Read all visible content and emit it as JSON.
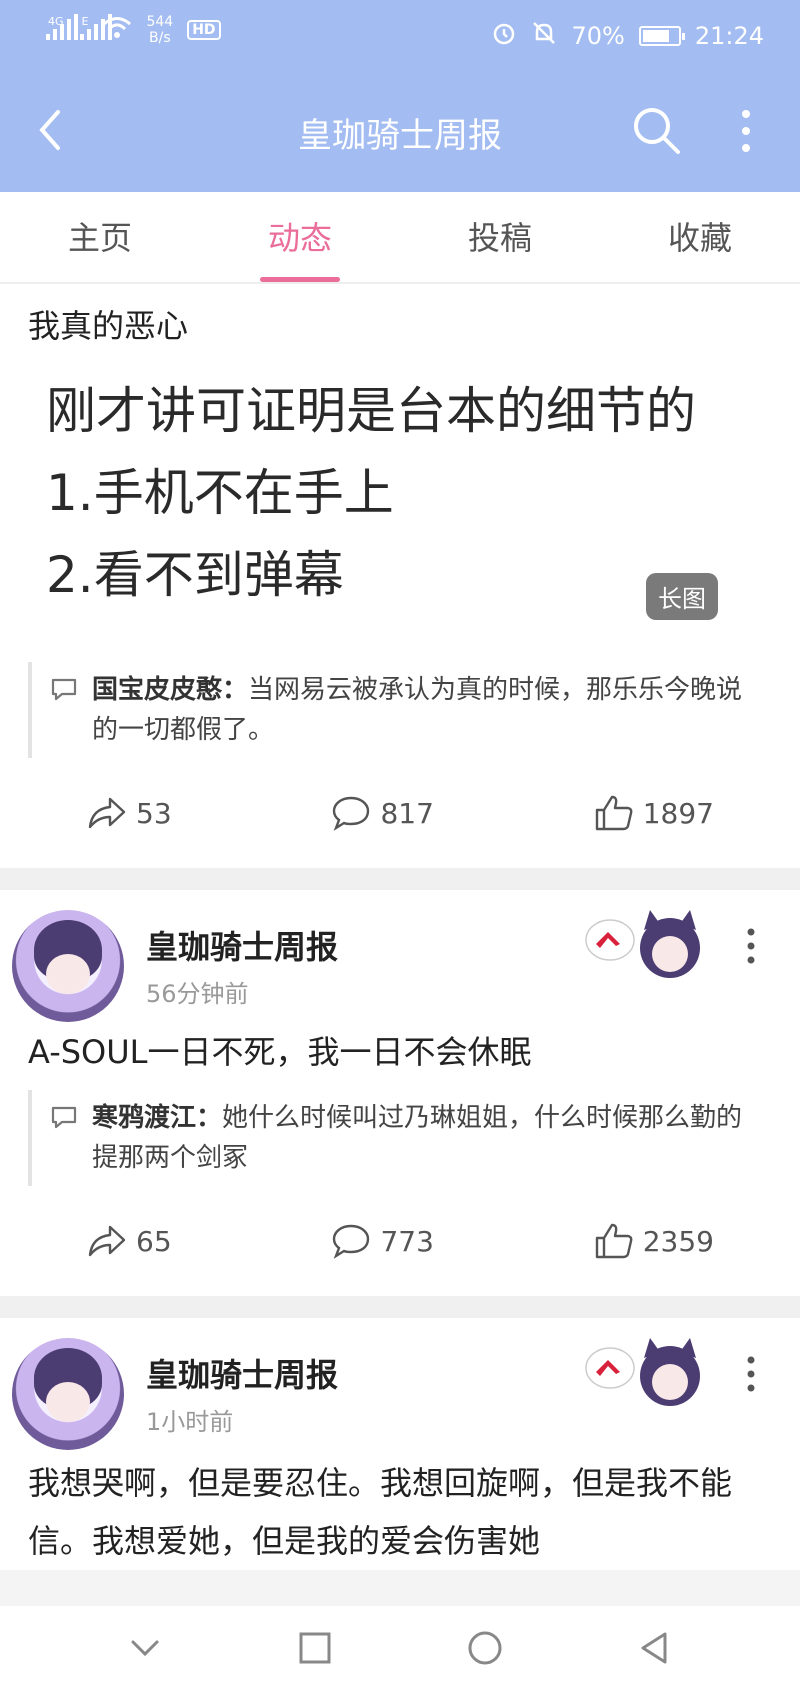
{
  "status_bar": {
    "net_a": "4G",
    "net_b": "E",
    "speed": "544",
    "speed_unit": "B/s",
    "hd": "HD",
    "battery": "70%",
    "time": "21:24"
  },
  "header": {
    "title": "皇珈骑士周报"
  },
  "tabs": [
    {
      "label": "主页"
    },
    {
      "label": "动态"
    },
    {
      "label": "投稿"
    },
    {
      "label": "收藏"
    }
  ],
  "posts": [
    {
      "text": "我真的恶心",
      "image_lines": [
        "刚才讲可证明是台本的细节的",
        "1.手机不在手上",
        "2.看不到弹幕"
      ],
      "image_badge": "长图",
      "reply_nick": "国宝皮皮憨：",
      "reply_text": "当网易云被承认为真的时候，那乐乐今晚说的一切都假了。",
      "shares": "53",
      "comments": "817",
      "likes": "1897"
    },
    {
      "author": "皇珈骑士周报",
      "time": "56分钟前",
      "text": "A-SOUL一日不死，我一日不会休眠",
      "reply_nick": "寒鸦渡江：",
      "reply_text": "她什么时候叫过乃琳姐姐，什么时候那么勤的提那两个剑冢",
      "shares": "65",
      "comments": "773",
      "likes": "2359"
    },
    {
      "author": "皇珈骑士周报",
      "time": "1小时前",
      "text": "我想哭啊，但是要忍住。我想回旋啊，但是我不能信。我想爱她，但是我的爱会伤害她"
    }
  ],
  "colors": {
    "header_bg": "#a3bcf1",
    "accent": "#ea6d9a"
  }
}
